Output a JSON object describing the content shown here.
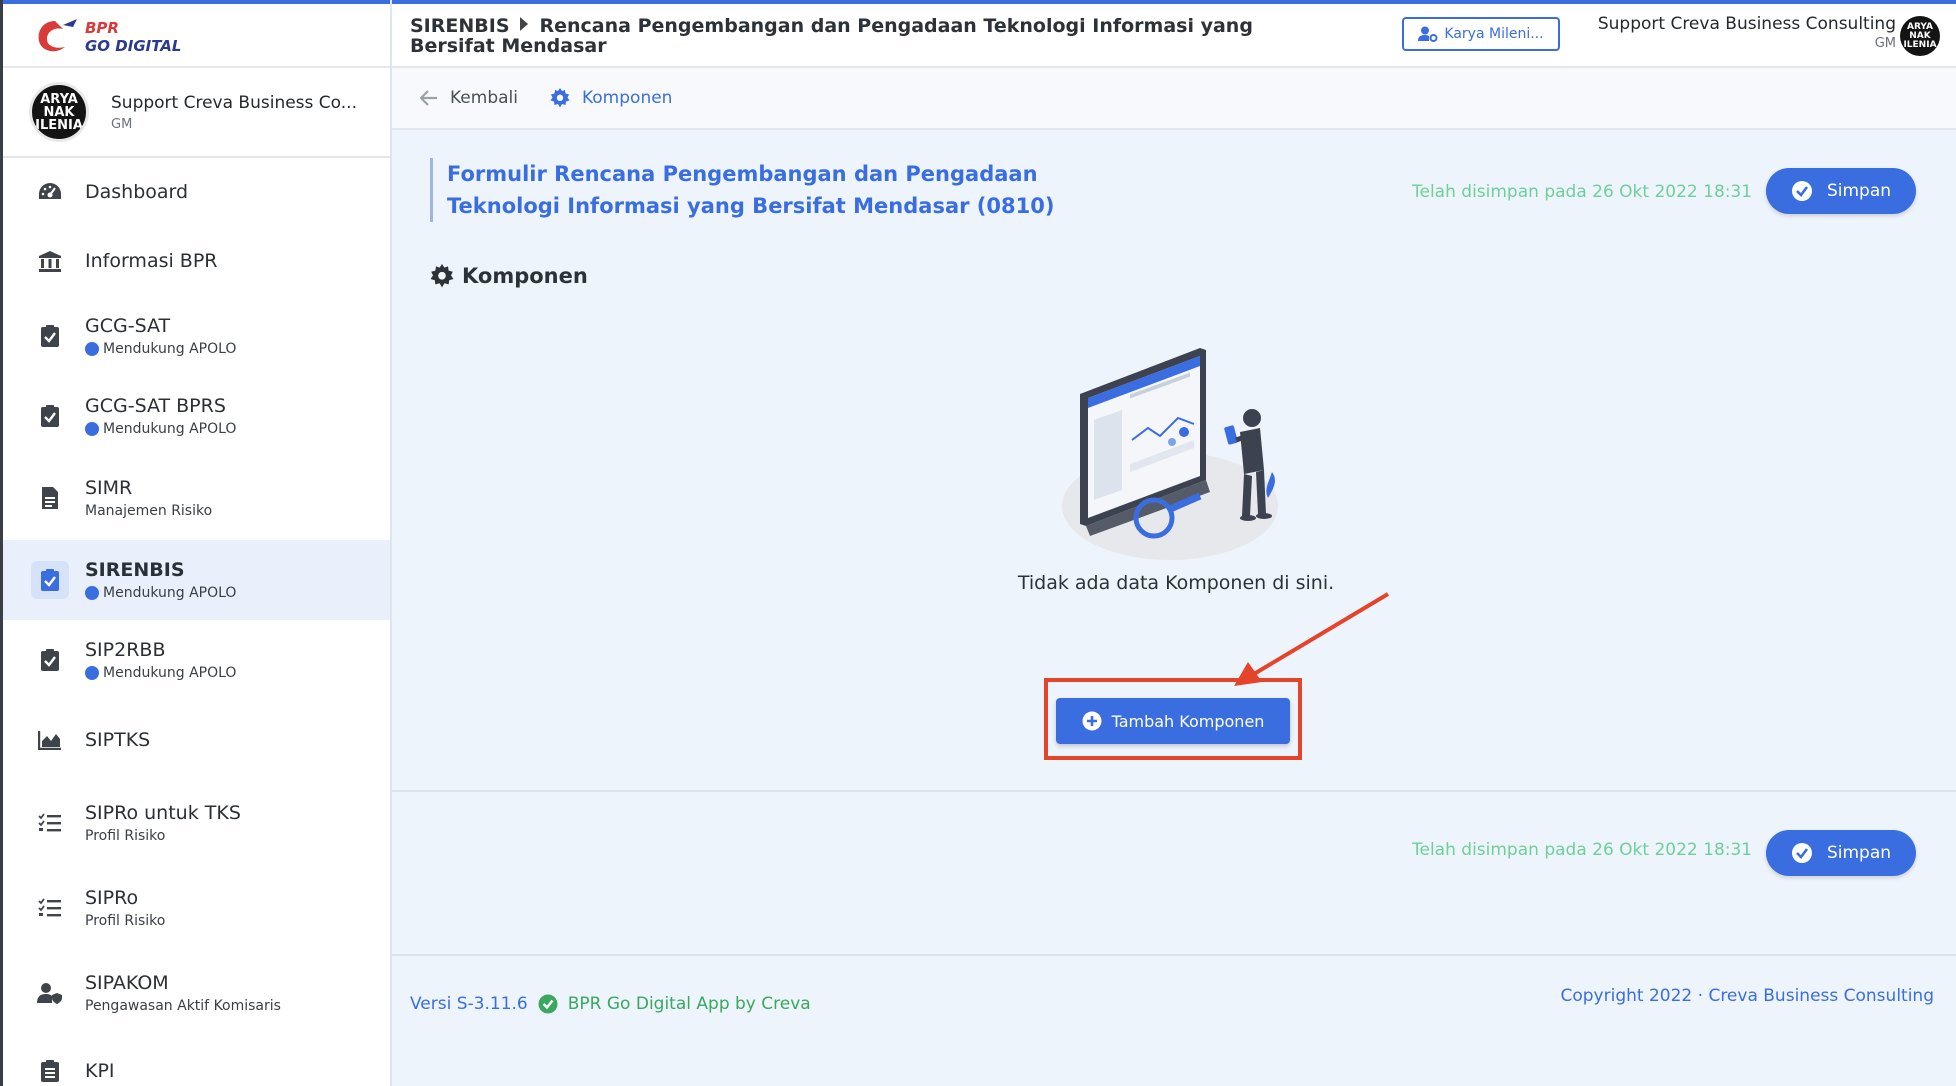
{
  "sidebar": {
    "profile": {
      "name": "Support Creva Business Co...",
      "role": "GM",
      "avatar_text": "ARYA NAK ILENIA"
    },
    "items": [
      {
        "title": "Dashboard",
        "sub": "",
        "icon": "dashboard-gauge-icon"
      },
      {
        "title": "Informasi BPR",
        "sub": "",
        "icon": "bank-building-icon"
      },
      {
        "title": "GCG-SAT",
        "sub": "Mendukung APOLO",
        "icon": "clipboard-check-icon"
      },
      {
        "title": "GCG-SAT BPRS",
        "sub": "Mendukung APOLO",
        "icon": "clipboard-check-icon"
      },
      {
        "title": "SIMR",
        "sub": "Manajemen Risiko",
        "icon": "document-icon"
      },
      {
        "title": "SIRENBIS",
        "sub": "Mendukung APOLO",
        "icon": "clipboard-check-icon"
      },
      {
        "title": "SIP2RBB",
        "sub": "Mendukung APOLO",
        "icon": "clipboard-check-icon"
      },
      {
        "title": "SIPTKS",
        "sub": "",
        "icon": "area-chart-icon"
      },
      {
        "title": "SIPRo untuk TKS",
        "sub": "Profil Risiko",
        "icon": "checklist-icon"
      },
      {
        "title": "SIPRo",
        "sub": "Profil Risiko",
        "icon": "checklist-icon"
      },
      {
        "title": "SIPAKOM",
        "sub": "Pengawasan Aktif Komisaris",
        "icon": "user-shield-icon"
      },
      {
        "title": "KPI",
        "sub": "",
        "icon": "clipboard-list-icon"
      }
    ]
  },
  "header": {
    "crumb_root": "SIRENBIS",
    "crumb_page": "Rencana Pengembangan dan Pengadaan Teknologi Informasi yang Bersifat Mendasar",
    "karya_button": "Karya Mileni...",
    "user_name": "Support Creva Business Consulting",
    "user_role": "GM",
    "avatar_text": "ARYA NAK ILENIA"
  },
  "subbar": {
    "back_label": "Kembali",
    "tab_label": "Komponen"
  },
  "main": {
    "form_title": "Formulir Rencana Pengembangan dan Pengadaan Teknologi Informasi yang Bersifat Mendasar (0810)",
    "saved_text": "Telah disimpan pada 26 Okt 2022 18:31",
    "save_label": "Simpan",
    "section_title": "Komponen",
    "empty_text": "Tidak ada data Komponen di sini.",
    "add_label": "Tambah Komponen"
  },
  "footer": {
    "version": "Versi S-3.11.6",
    "app": "BPR Go Digital App by Creva",
    "copyright": "Copyright 2022 · Creva Business Consulting"
  },
  "colors": {
    "accent": "#3a6ee0",
    "success": "#6fcf9a",
    "annotation": "#e5432a"
  }
}
